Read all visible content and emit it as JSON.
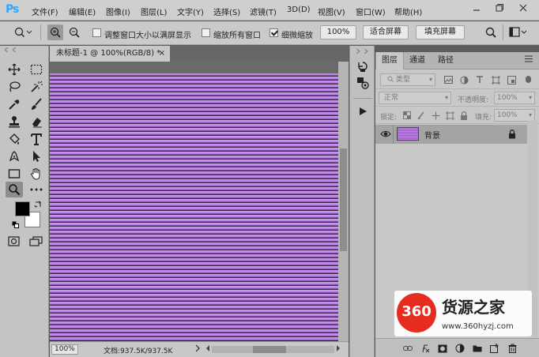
{
  "app": {
    "logo": "Ps"
  },
  "menu": {
    "items": [
      {
        "label": "文件(F)"
      },
      {
        "label": "编辑(E)"
      },
      {
        "label": "图像(I)"
      },
      {
        "label": "图层(L)"
      },
      {
        "label": "文字(Y)"
      },
      {
        "label": "选择(S)"
      },
      {
        "label": "滤镜(T)"
      },
      {
        "label": "3D(D)"
      },
      {
        "label": "视图(V)"
      },
      {
        "label": "窗口(W)"
      },
      {
        "label": "帮助(H)"
      }
    ]
  },
  "options": {
    "resize_windows_label": "调整窗口大小以满屏显示",
    "resize_windows_checked": false,
    "zoom_all_label": "缩放所有窗口",
    "zoom_all_checked": false,
    "scrubby_zoom_label": "细微缩放",
    "scrubby_zoom_checked": true,
    "zoom_percent": "100%",
    "fit_screen_label": "适合屏幕",
    "fill_screen_label": "填充屏幕"
  },
  "document": {
    "tab_title": "未标题-1 @ 100%(RGB/8) *",
    "close_glyph": "×",
    "pattern_colors": [
      "#c68cf0",
      "#3a2a4a"
    ]
  },
  "status": {
    "zoom": "100%",
    "doc_info": "文档:937.5K/937.5K"
  },
  "colors": {
    "foreground": "#000000",
    "background": "#ffffff"
  },
  "layers_panel": {
    "tabs": [
      {
        "label": "图层"
      },
      {
        "label": "通道"
      },
      {
        "label": "路径"
      }
    ],
    "filter_placeholder": "类型",
    "blend_mode": "正常",
    "opacity_label": "不透明度:",
    "opacity_value": "100%",
    "lock_label": "锁定:",
    "fill_label": "填充:",
    "fill_value": "100%",
    "layers": [
      {
        "name": "背景",
        "visible": true,
        "locked": true
      }
    ]
  },
  "watermark": {
    "number": "360",
    "title": "货源之家",
    "url": "www.360hyzj.com"
  }
}
